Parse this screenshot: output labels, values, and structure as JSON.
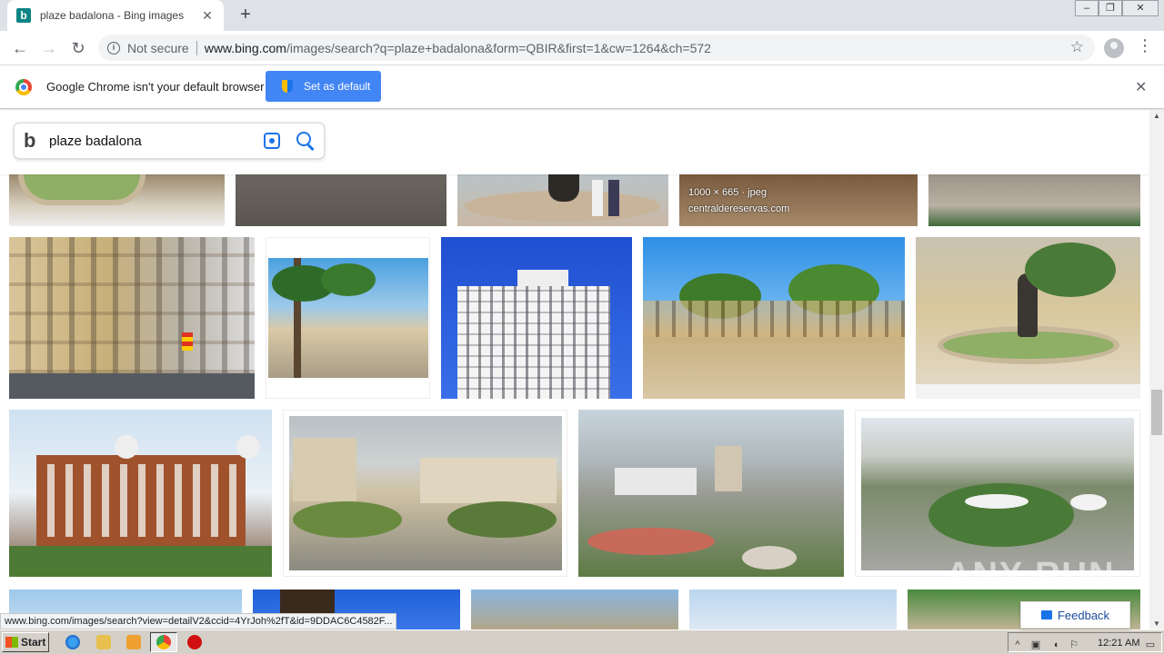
{
  "browser": {
    "tab_title": "plaze badalona - Bing images",
    "tab_favicon": "b",
    "new_tab_label": "+",
    "security_label": "Not secure",
    "url_host": "www.bing.com",
    "url_path": "/images/search?q=plaze+badalona&form=QBIR&first=1&cw=1264&ch=572"
  },
  "infobar": {
    "message": "Google Chrome isn't your default browser",
    "button_label": "Set as default"
  },
  "search": {
    "query": "plaze badalona"
  },
  "results": {
    "row0_overlay_size": "1000 × 665 · jpeg",
    "row0_overlay_source": "centraldereservas.com"
  },
  "status_url": "www.bing.com/images/search?view=detailV2&ccid=4YrJoh%2fT&id=9DDAC6C4582F...",
  "feedback_label": "Feedback",
  "watermark": "ANY RUN",
  "taskbar": {
    "start_label": "Start",
    "clock": "12:21 AM"
  },
  "colors": {
    "accent": "#4285f4",
    "bing_blue": "#1a73e8"
  }
}
